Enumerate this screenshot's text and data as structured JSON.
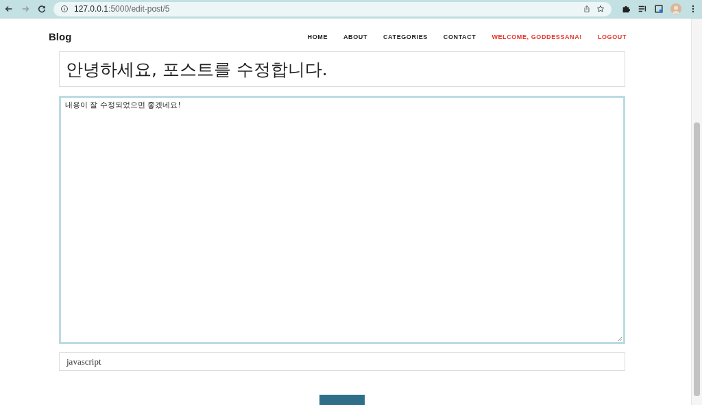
{
  "browser": {
    "url_host": "127.0.0.1",
    "url_path": ":5000/edit-post/5"
  },
  "site": {
    "brand": "Blog",
    "nav": [
      {
        "label": "HOME",
        "kind": "link"
      },
      {
        "label": "ABOUT",
        "kind": "link"
      },
      {
        "label": "CATEGORIES",
        "kind": "link"
      },
      {
        "label": "CONTACT",
        "kind": "link"
      },
      {
        "label": "WELCOME, GODDESSANA!",
        "kind": "accent"
      },
      {
        "label": "LOGOUT",
        "kind": "accent"
      }
    ]
  },
  "form": {
    "title": "안녕하세요, 포스트를 수정합니다.",
    "content": "내용이 잘 수정되었으면 좋겠네요!",
    "content_focused": true,
    "tags": "javascript"
  }
}
